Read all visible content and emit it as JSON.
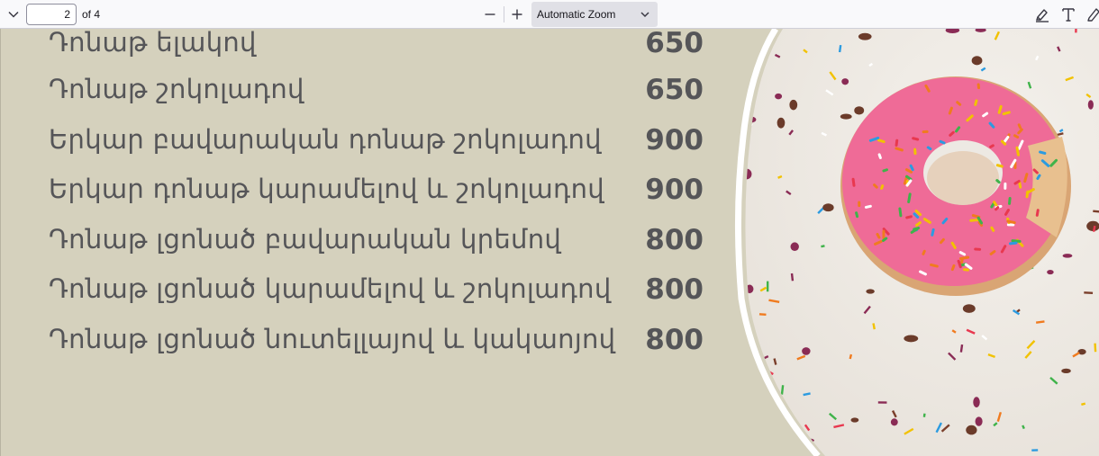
{
  "toolbar": {
    "page_number": "2",
    "page_count": "of 4",
    "zoom_label": "Automatic Zoom",
    "icons": [
      "sidebar-chevron-icon",
      "zoom-out-icon",
      "zoom-in-icon",
      "dropdown-chevron-icon",
      "highlight-icon",
      "text-icon",
      "draw-icon"
    ]
  },
  "menu": {
    "items": [
      {
        "name": "Դոնաթ ելակով",
        "price": "650"
      },
      {
        "name": "Դոնաթ շոկոլադով",
        "price": "650"
      },
      {
        "name": "Երկար բավարական դոնաթ շոկոլադով",
        "price": "900"
      },
      {
        "name": "Երկար դոնաթ կարամելով և շոկոլադով",
        "price": "900"
      },
      {
        "name": "Դոնաթ լցոնած բավարական կրեմով",
        "price": "800"
      },
      {
        "name": "Դոնաթ լցոնած կարամելով և շոկոլադով",
        "price": "800"
      },
      {
        "name": "Դոնաթ լցոնած նուտելլայով և կակաոյով",
        "price": "800"
      }
    ]
  },
  "colors": {
    "page_background": "#d5d1bd",
    "text": "#555558",
    "icing": "#ef6b97",
    "dough": "#e0b27e"
  }
}
